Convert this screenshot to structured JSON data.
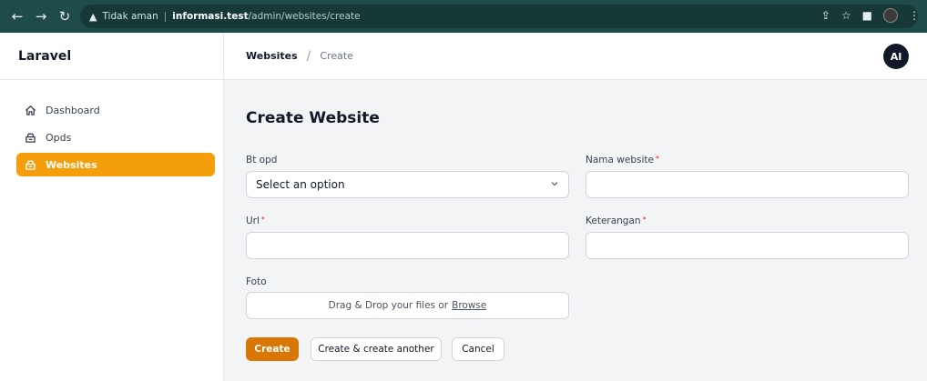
{
  "browser": {
    "security_label": "Tidak aman",
    "url_host": "informasi.test",
    "url_path": "/admin/websites/create"
  },
  "sidebar": {
    "brand": "Laravel",
    "items": [
      {
        "label": "Dashboard",
        "icon": "home-icon",
        "active": false
      },
      {
        "label": "Opds",
        "icon": "box-icon",
        "active": false
      },
      {
        "label": "Websites",
        "icon": "box-icon",
        "active": true
      }
    ]
  },
  "topbar": {
    "breadcrumb": [
      "Websites",
      "Create"
    ],
    "avatar_initials": "AI"
  },
  "form": {
    "title": "Create Website",
    "fields": {
      "bt_opd": {
        "label": "Bt opd",
        "value": "Select an option",
        "required": false
      },
      "nama_website": {
        "label": "Nama website",
        "value": "",
        "required": true
      },
      "url": {
        "label": "Url",
        "value": "",
        "required": true
      },
      "keterangan": {
        "label": "Keterangan",
        "value": "",
        "required": true
      },
      "foto": {
        "label": "Foto",
        "drop_text": "Drag & Drop your files or",
        "browse_text": "Browse"
      }
    },
    "buttons": {
      "create": "Create",
      "create_another": "Create & create another",
      "cancel": "Cancel"
    }
  },
  "colors": {
    "accent": "#f59e0b",
    "primary_button": "#d97706",
    "required_marker": "#dc2626",
    "browser_chrome": "#1f4b4a"
  }
}
